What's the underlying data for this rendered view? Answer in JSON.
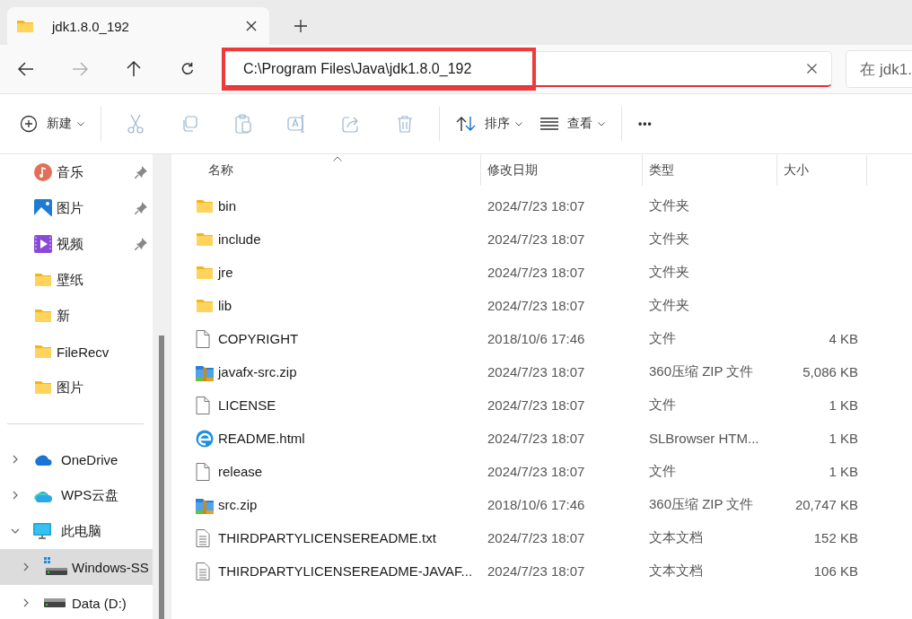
{
  "tabs": [
    {
      "title": "jdk1.8.0_192",
      "selected": true
    }
  ],
  "navigation": [
    {
      "kind": "back",
      "disabled": false
    },
    {
      "kind": "forward",
      "disabled": true
    },
    {
      "kind": "up",
      "disabled": false
    },
    {
      "kind": "refresh",
      "disabled": false
    }
  ],
  "address_bar": {
    "value": "C:\\Program Files\\Java\\jdk1.8.0_192",
    "highlighted": true
  },
  "search": {
    "placeholder": "在 jdk1."
  },
  "toolbar": [
    {
      "kind": "new",
      "label": "新建",
      "disabled": false
    },
    {
      "kind": "separator"
    },
    {
      "kind": "cut",
      "disabled": true
    },
    {
      "kind": "copy",
      "disabled": true
    },
    {
      "kind": "paste",
      "disabled": true
    },
    {
      "kind": "rename",
      "disabled": true
    },
    {
      "kind": "share",
      "disabled": true
    },
    {
      "kind": "delete",
      "disabled": true
    },
    {
      "kind": "separator"
    },
    {
      "kind": "sort",
      "label": "排序",
      "disabled": false
    },
    {
      "kind": "view",
      "label": "查看",
      "disabled": false
    },
    {
      "kind": "separator"
    },
    {
      "kind": "more",
      "label": "•••",
      "disabled": false
    }
  ],
  "sidebar": {
    "quick_access": [
      {
        "label": "音乐",
        "kind": "music",
        "pinned": true
      },
      {
        "label": "图片",
        "kind": "pictures",
        "pinned": true
      },
      {
        "label": "视频",
        "kind": "videos",
        "pinned": true
      },
      {
        "label": "壁纸",
        "kind": "folder",
        "pinned": false
      },
      {
        "label": "新",
        "kind": "folder",
        "pinned": false
      },
      {
        "label": "FileRecv",
        "kind": "folder",
        "pinned": false
      },
      {
        "label": "图片",
        "kind": "folder",
        "pinned": false
      }
    ],
    "tree": [
      {
        "label": "OneDrive",
        "kind": "onedrive",
        "expanded": false,
        "selected": false
      },
      {
        "label": "WPS云盘",
        "kind": "wps",
        "expanded": false,
        "selected": false
      },
      {
        "label": "此电脑",
        "kind": "pc",
        "expanded": true,
        "selected": false,
        "children": [
          {
            "label": "Windows-SS",
            "kind": "system-drive",
            "expanded": false,
            "selected": true
          },
          {
            "label": "Data (D:)",
            "kind": "drive",
            "expanded": false,
            "selected": false
          }
        ]
      }
    ]
  },
  "table": {
    "columns": [
      {
        "label": "名称",
        "sorted": true
      },
      {
        "label": "修改日期",
        "sorted": false
      },
      {
        "label": "类型",
        "sorted": false
      },
      {
        "label": "大小",
        "sorted": false
      }
    ],
    "rows": [
      {
        "name": "bin",
        "kind": "folder",
        "modified": "2024/7/23 18:07",
        "type": "文件夹"
      },
      {
        "name": "include",
        "kind": "folder",
        "modified": "2024/7/23 18:07",
        "type": "文件夹"
      },
      {
        "name": "jre",
        "kind": "folder",
        "modified": "2024/7/23 18:07",
        "type": "文件夹"
      },
      {
        "name": "lib",
        "kind": "folder",
        "modified": "2024/7/23 18:07",
        "type": "文件夹"
      },
      {
        "name": "COPYRIGHT",
        "kind": "file",
        "modified": "2018/10/6 17:46",
        "type": "文件",
        "size": "4 KB"
      },
      {
        "name": "javafx-src.zip",
        "kind": "zip",
        "modified": "2024/7/23 18:07",
        "type": "360压缩 ZIP 文件",
        "size": "5,086 KB"
      },
      {
        "name": "LICENSE",
        "kind": "file",
        "modified": "2024/7/23 18:07",
        "type": "文件",
        "size": "1 KB"
      },
      {
        "name": "README.html",
        "kind": "html",
        "modified": "2024/7/23 18:07",
        "type": "SLBrowser HTM...",
        "size": "1 KB"
      },
      {
        "name": "release",
        "kind": "file",
        "modified": "2024/7/23 18:07",
        "type": "文件",
        "size": "1 KB"
      },
      {
        "name": "src.zip",
        "kind": "zip",
        "modified": "2018/10/6 17:46",
        "type": "360压缩 ZIP 文件",
        "size": "20,747 KB"
      },
      {
        "name": "THIRDPARTYLICENSEREADME.txt",
        "kind": "text",
        "modified": "2024/7/23 18:07",
        "type": "文本文档",
        "size": "152 KB"
      },
      {
        "name": "THIRDPARTYLICENSEREADME-JAVAF...",
        "kind": "text",
        "modified": "2024/7/23 18:07",
        "type": "文本文档",
        "size": "106 KB"
      }
    ]
  }
}
